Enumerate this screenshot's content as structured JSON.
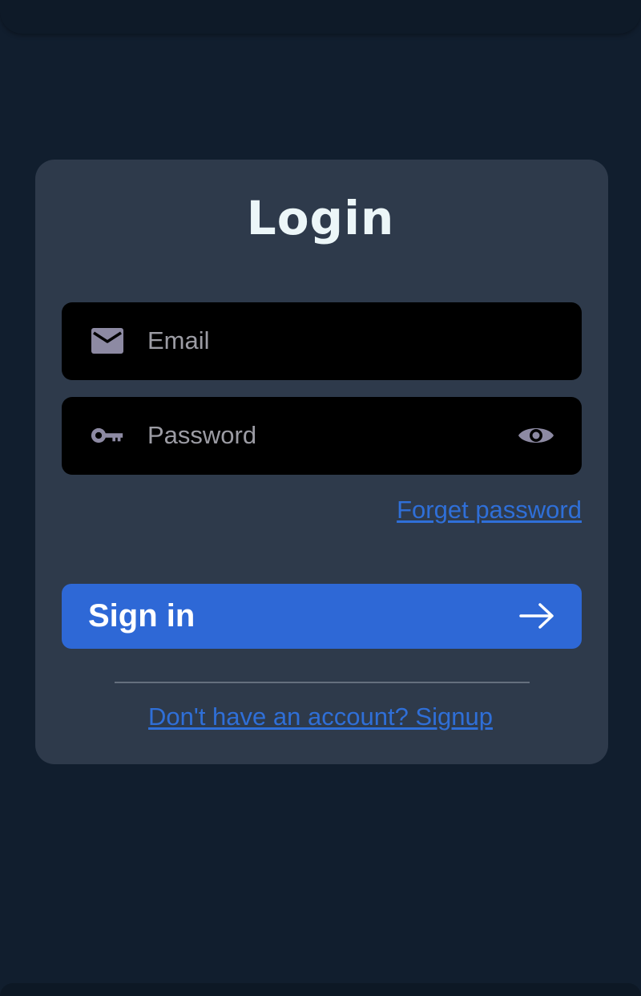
{
  "login": {
    "title": "Login",
    "email": {
      "placeholder": "Email",
      "value": "",
      "icon": "mail-icon"
    },
    "password": {
      "placeholder": "Password",
      "value": "",
      "icon": "key-icon",
      "toggle_icon": "eye-icon"
    },
    "forget_password": "Forget password",
    "signin_label": "Sign in",
    "signin_icon": "arrow-right-icon",
    "signup_prompt": "Don't have an account? Signup"
  },
  "colors": {
    "background": "#111e2e",
    "card": "#2e3a4b",
    "field": "#000000",
    "accent": "#2e68d6",
    "link": "#2f6fd8",
    "title": "#ecf6f8",
    "icon": "#8d8aa3"
  }
}
